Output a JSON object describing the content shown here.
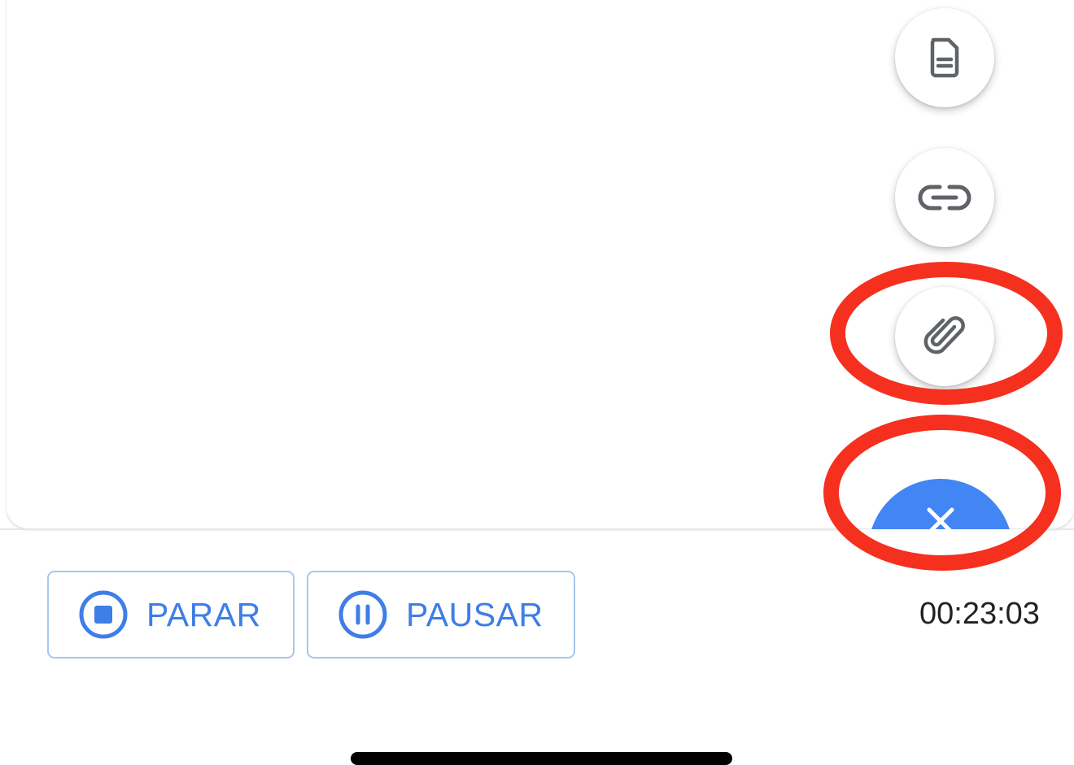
{
  "speed_dial": {
    "items": [
      {
        "icon": "document-icon"
      },
      {
        "icon": "link-icon"
      },
      {
        "icon": "paperclip-icon"
      }
    ],
    "main": {
      "icon": "close-icon",
      "color": "#4285f4"
    }
  },
  "annotation": {
    "color": "#f5301f"
  },
  "actions": {
    "stop_label": "PARAR",
    "pause_label": "PAUSAR",
    "accent": "#3e7ee6"
  },
  "status": {
    "timer": "00:23:03"
  }
}
